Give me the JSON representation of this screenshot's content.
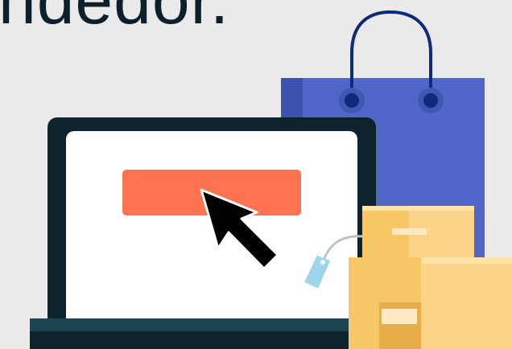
{
  "headline": {
    "text": "ndedor."
  },
  "illustration": {
    "icons": [
      "shopping-bag-icon",
      "laptop-icon",
      "buy-button",
      "mouse-cursor-icon",
      "price-tag-icon",
      "cardboard-boxes-icon"
    ],
    "colors": {
      "background": "#eaeaea",
      "text": "#0d1f2a",
      "bag": "#5067c9",
      "laptop_frame": "#0d232d",
      "laptop_base": "#1c4453",
      "screen": "#ffffff",
      "button": "#ff7350",
      "cursor": "#000000",
      "tag": "#9dd5ec",
      "box_front": "#f8c766",
      "box_side": "#e8ae49"
    }
  }
}
